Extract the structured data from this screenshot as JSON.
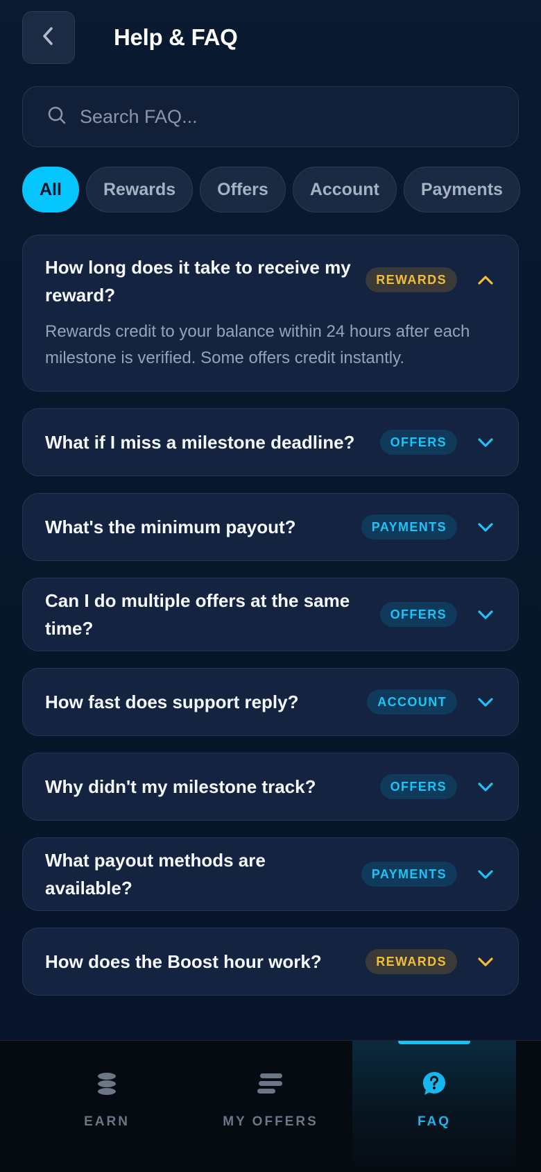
{
  "header": {
    "title": "Help & FAQ"
  },
  "search": {
    "placeholder": "Search FAQ..."
  },
  "filters": [
    "All",
    "Rewards",
    "Offers",
    "Account",
    "Payments"
  ],
  "faqs": [
    {
      "question": "How long does it take to receive my reward?",
      "category": "REWARDS",
      "expanded": true,
      "answer": "Rewards credit to your balance within 24 hours after each milestone is verified. Some offers credit instantly."
    },
    {
      "question": "What if I miss a milestone deadline?",
      "category": "OFFERS"
    },
    {
      "question": "What's the minimum payout?",
      "category": "PAYMENTS"
    },
    {
      "question": "Can I do multiple offers at the same time?",
      "category": "OFFERS"
    },
    {
      "question": "How fast does support reply?",
      "category": "ACCOUNT"
    },
    {
      "question": "Why didn't my milestone track?",
      "category": "OFFERS"
    },
    {
      "question": "What payout methods are available?",
      "category": "PAYMENTS"
    },
    {
      "question": "How does the Boost hour work?",
      "category": "REWARDS"
    }
  ],
  "nav": {
    "earn": "EARN",
    "my_offers": "MY OFFERS",
    "faq": "FAQ"
  },
  "colors": {
    "accent": "#06c6ff",
    "rewards_badge": "#f3be33",
    "background": "#081529"
  }
}
